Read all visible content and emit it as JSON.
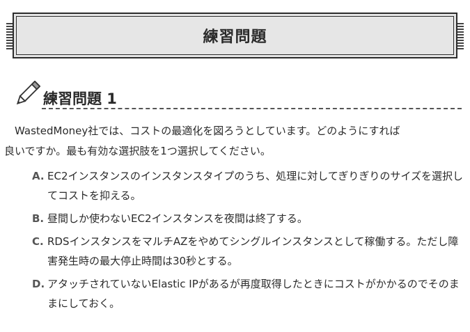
{
  "banner": {
    "title": "練習問題"
  },
  "section": {
    "title": "練習問題 1"
  },
  "question": {
    "line1": "WastedMoney社では、コストの最適化を図ろうとしています。どのようにすれば",
    "line2": "良いですか。最も有効な選択肢を1つ選択してください。"
  },
  "options": [
    {
      "letter": "A.",
      "text": "EC2インスタンスのインスタンスタイプのうち、処理に対してぎりぎりのサイズを選択してコストを抑える。"
    },
    {
      "letter": "B.",
      "text": "昼間しか使わないEC2インスタンスを夜間は終了する。"
    },
    {
      "letter": "C.",
      "text": "RDSインスタンスをマルチAZをやめてシングルインスタンスとして稼働する。ただし障害発生時の最大停止時間は30秒とする。"
    },
    {
      "letter": "D.",
      "text": "アタッチされていないElastic IPがあるが再度取得したときにコストがかかるのでそのままにしておく。"
    }
  ],
  "colors": {
    "banner_bg": "#e6e6e6",
    "border": "#2c2c2c",
    "letter": "#555555"
  }
}
